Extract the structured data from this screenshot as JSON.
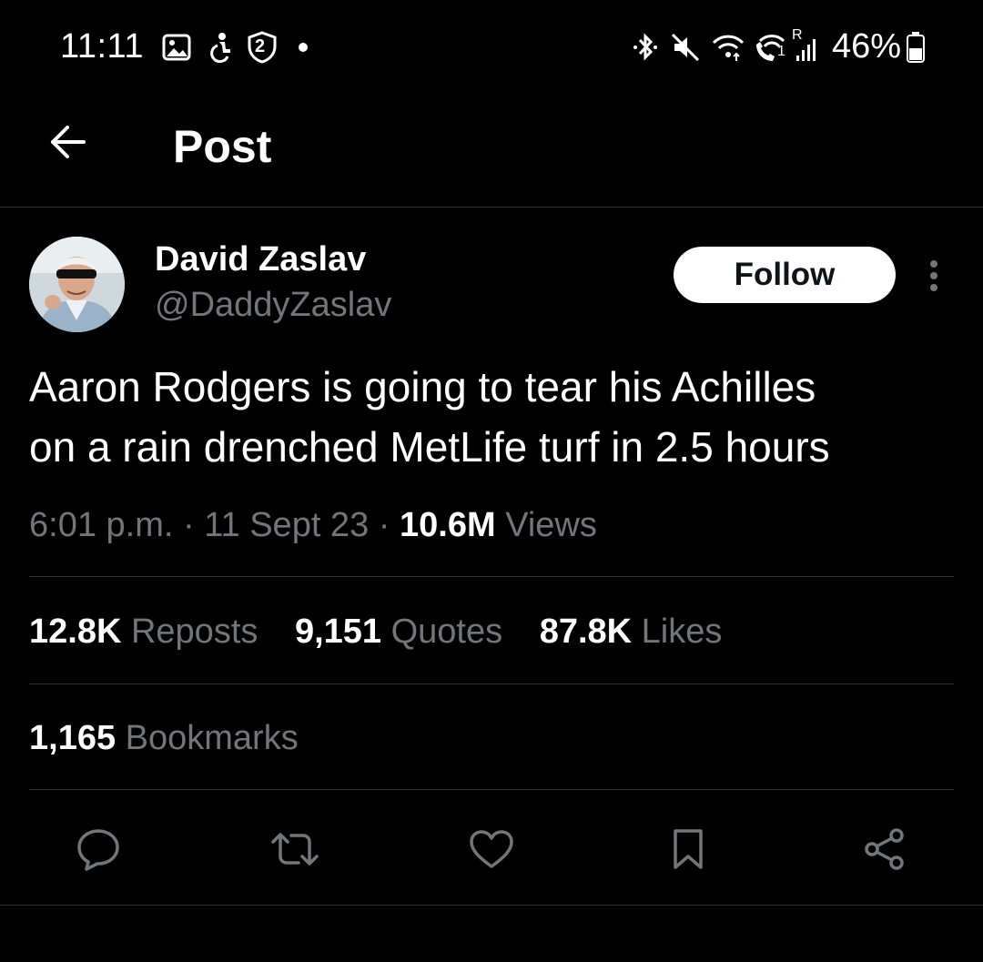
{
  "status_bar": {
    "time": "11:11",
    "notification_badge": "2",
    "battery_percent": "46%",
    "signal_label": "R",
    "sim_label": "1",
    "icons": [
      "gallery-icon",
      "accessibility-icon",
      "shield-badge-icon",
      "dot-icon",
      "bluetooth-icon",
      "mute-icon",
      "wifi-icon",
      "wifi-call-icon",
      "signal-icon",
      "battery-icon"
    ]
  },
  "header": {
    "title": "Post",
    "back_icon": "arrow-left-icon"
  },
  "author": {
    "name": "David Zaslav",
    "handle": "@DaddyZaslav",
    "follow_label": "Follow"
  },
  "tweet": {
    "text_line1": "Aaron Rodgers is going to tear his Achilles",
    "text_line2": "on a rain drenched MetLife turf in 2.5 hours",
    "time": "6:01 p.m.",
    "separator": "·",
    "date": "11 Sept 23",
    "views_count": "10.6M",
    "views_label": "Views"
  },
  "stats": {
    "reposts_count": "12.8K",
    "reposts_label": "Reposts",
    "quotes_count": "9,151",
    "quotes_label": "Quotes",
    "likes_count": "87.8K",
    "likes_label": "Likes",
    "bookmarks_count": "1,165",
    "bookmarks_label": "Bookmarks"
  },
  "actions": [
    "reply-icon",
    "repost-icon",
    "like-icon",
    "bookmark-icon",
    "share-icon"
  ],
  "colors": {
    "background": "#000000",
    "text_primary": "#ffffff",
    "text_secondary": "#71767b",
    "divider": "#2f3336",
    "follow_bg": "#ffffff"
  }
}
